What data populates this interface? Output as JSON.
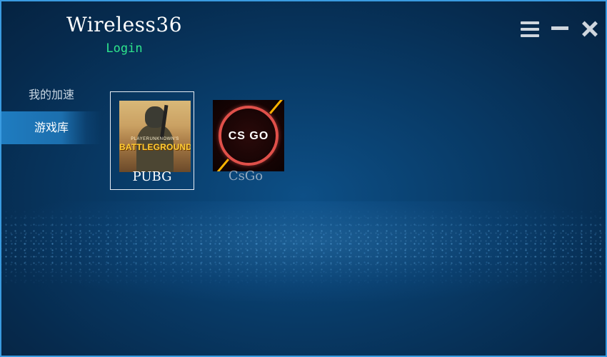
{
  "window": {
    "border_color": "#3a9be0",
    "bg_color": "#073563"
  },
  "header": {
    "title": "Wireless36",
    "login_label": "Login",
    "login_color": "#2ee58c"
  },
  "controls": {
    "menu_icon": "menu-icon",
    "minimize_icon": "minimize-icon",
    "close_icon": "close-icon"
  },
  "sidebar": {
    "items": [
      {
        "label": "我的加速",
        "active": false
      },
      {
        "label": "游戏库",
        "active": true
      }
    ]
  },
  "games": [
    {
      "name": "PUBG",
      "selected": true,
      "thumb_lines": [
        "PLAYERUNKNOWN'S",
        "BATTLEGROUNDS"
      ]
    },
    {
      "name": "CsGo",
      "selected": false,
      "thumb_logo": "CS GO"
    }
  ]
}
